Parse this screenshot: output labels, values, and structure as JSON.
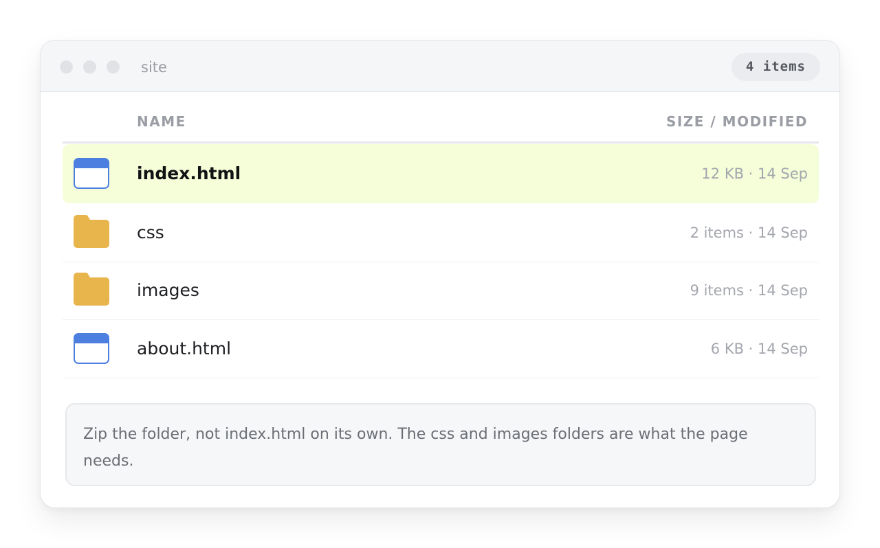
{
  "window": {
    "title": "site",
    "item_count": "4 items"
  },
  "columns": {
    "name": "NAME",
    "size_modified": "SIZE / MODIFIED"
  },
  "rows": [
    {
      "name": "index.html",
      "meta": "12 KB · 14 Sep",
      "kind": "html-file-icon",
      "selected": true
    },
    {
      "name": "css",
      "meta": "2 items · 14 Sep",
      "kind": "folder-icon",
      "selected": false
    },
    {
      "name": "images",
      "meta": "9 items · 14 Sep",
      "kind": "folder-icon",
      "selected": false
    },
    {
      "name": "about.html",
      "meta": "6 KB · 14 Sep",
      "kind": "html-file-icon",
      "selected": false
    }
  ],
  "note": "Zip the folder, not index.html on its own. The css and images folders are what the page needs.",
  "colors": {
    "selected_row": "#f5fed9",
    "folder": "#e8b54d",
    "html_file": "#4d7fe0"
  }
}
